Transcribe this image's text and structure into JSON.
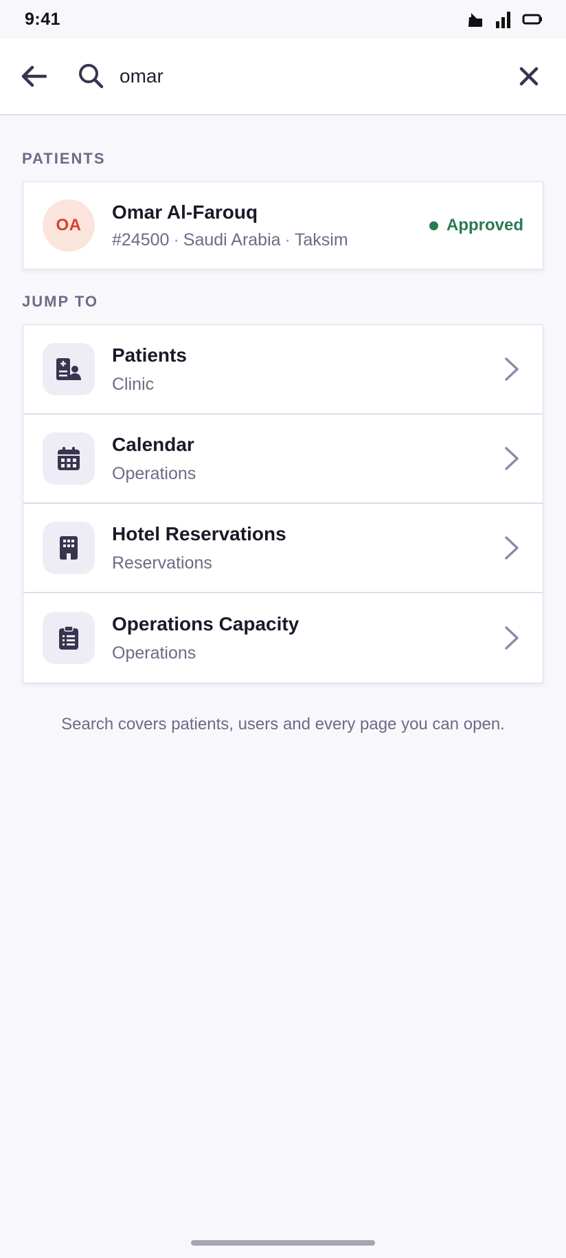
{
  "status_bar": {
    "time": "9:41",
    "icons": [
      "notification-icon",
      "signal-icon",
      "battery-icon"
    ]
  },
  "search": {
    "value": "omar",
    "back_icon": "arrow-left-icon",
    "search_icon": "search-icon",
    "clear_icon": "close-icon"
  },
  "patients_section": {
    "label": "PATIENTS",
    "items": [
      {
        "initials": "OA",
        "name": "Omar Al-Farouq",
        "id": "#24500",
        "country": "Saudi Arabia",
        "location": "Taksim",
        "separator": "·",
        "status": "Approved",
        "status_color": "#2a7a52"
      }
    ]
  },
  "jump_section": {
    "label": "JUMP TO",
    "items": [
      {
        "title": "Patients",
        "subtitle": "Clinic",
        "icon": "patient-list-icon"
      },
      {
        "title": "Calendar",
        "subtitle": "Operations",
        "icon": "calendar-icon"
      },
      {
        "title": "Hotel Reservations",
        "subtitle": "Reservations",
        "icon": "building-icon"
      },
      {
        "title": "Operations Capacity",
        "subtitle": "Operations",
        "icon": "clipboard-list-icon"
      }
    ]
  },
  "footer": {
    "note": "Search covers patients, users and every page you can open."
  },
  "colors": {
    "background": "#f8f7fc",
    "accent_dark": "#3a3450",
    "avatar_bg": "#fbe4dc",
    "avatar_text": "#d4432a",
    "approved": "#2a7a52"
  }
}
